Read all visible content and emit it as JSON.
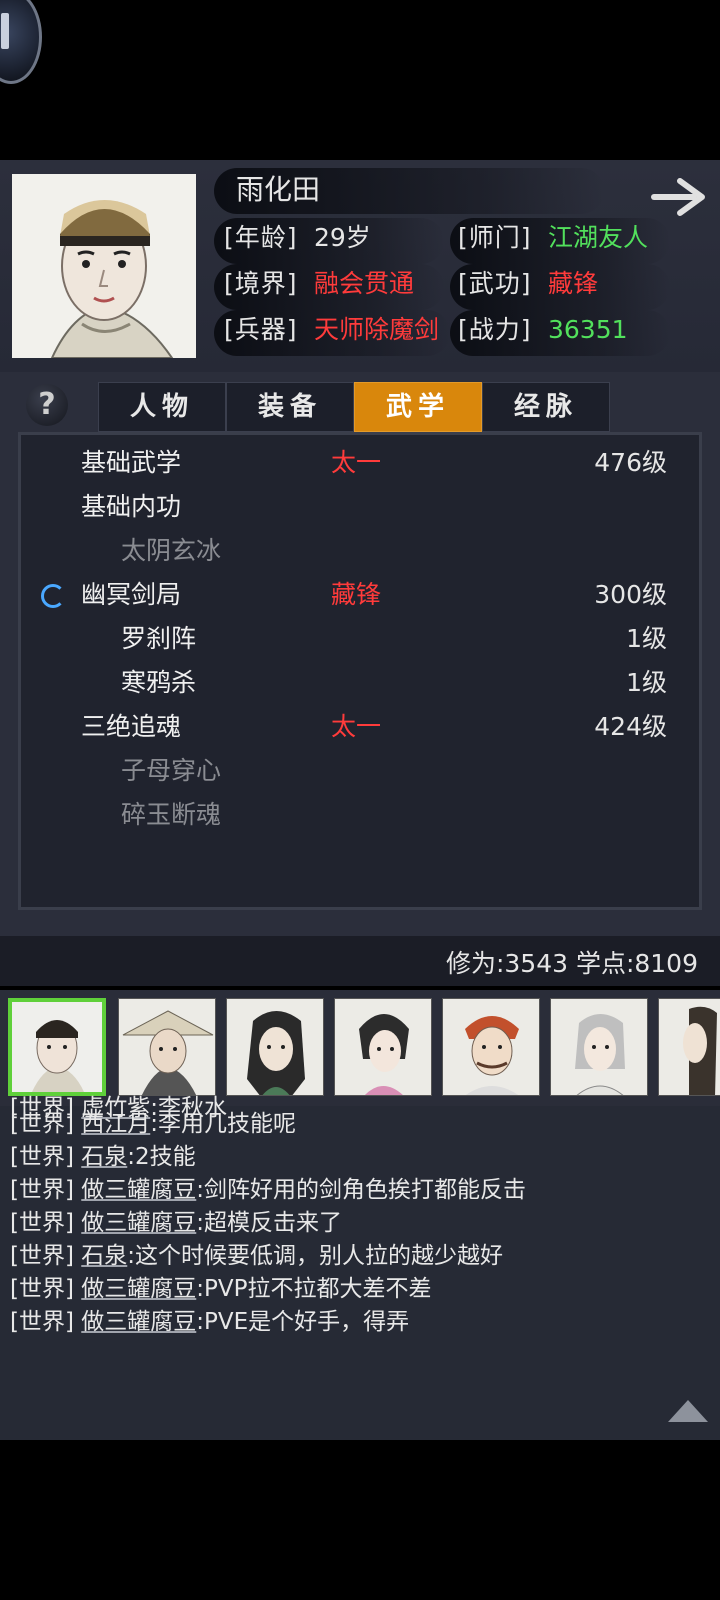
{
  "profile": {
    "name": "雨化田",
    "age_label": "[年龄]",
    "age_value": "29岁",
    "sect_label": "[师门]",
    "sect_value": "江湖友人",
    "realm_label": "[境界]",
    "realm_value": "融会贯通",
    "martial_label": "[武功]",
    "martial_value": "藏锋",
    "weapon_label": "[兵器]",
    "weapon_value": "天师除魔剑",
    "power_label": "[战力]",
    "power_value": "36351"
  },
  "help_glyph": "?",
  "tabs": [
    {
      "label": "人物"
    },
    {
      "label": "装备"
    },
    {
      "label": "武学",
      "active": true
    },
    {
      "label": "经脉"
    }
  ],
  "skills": [
    {
      "name": "基础武学",
      "style": "太一",
      "level": "476级"
    },
    {
      "name": "基础内功",
      "style": "",
      "level": ""
    },
    {
      "name": "太阴玄冰",
      "style": "",
      "level": "",
      "sub": true,
      "dim": true
    },
    {
      "name": "幽冥剑局",
      "style": "藏锋",
      "level": "300级",
      "active": true
    },
    {
      "name": "罗刹阵",
      "style": "",
      "level": "1级",
      "sub": true
    },
    {
      "name": "寒鸦杀",
      "style": "",
      "level": "1级",
      "sub": true
    },
    {
      "name": "三绝追魂",
      "style": "太一",
      "level": "424级"
    },
    {
      "name": "子母穿心",
      "style": "",
      "level": "",
      "sub": true,
      "dim": true
    },
    {
      "name": "碎玉断魂",
      "style": "",
      "level": "",
      "sub": true,
      "dim": true
    }
  ],
  "stats": {
    "text": "修为:3543  学点:8109"
  },
  "chat": [
    {
      "channel": "[世界]",
      "user": "虚竹紫",
      "text": ":李秋水"
    },
    {
      "channel": "[世界]",
      "user": "西江月",
      "text": ":李用几技能呢"
    },
    {
      "channel": "[世界]",
      "user": "石泉",
      "text": ":2技能"
    },
    {
      "channel": "[世界]",
      "user": "做三罐腐豆",
      "text": ":剑阵好用的剑角色挨打都能反击"
    },
    {
      "channel": "[世界]",
      "user": "做三罐腐豆",
      "text": ":超模反击来了"
    },
    {
      "channel": "[世界]",
      "user": "石泉",
      "text": ":这个时候要低调，别人拉的越少越好"
    },
    {
      "channel": "[世界]",
      "user": "做三罐腐豆",
      "text": ":PVP拉不拉都大差不差"
    },
    {
      "channel": "[世界]",
      "user": "做三罐腐豆",
      "text": ":PVE是个好手，得弄"
    }
  ],
  "colors": {
    "active_tab": "#d9870c",
    "green_value": "#52e05c",
    "red_value": "#ff3b3b",
    "selected_portrait_border": "#5fd03a"
  }
}
